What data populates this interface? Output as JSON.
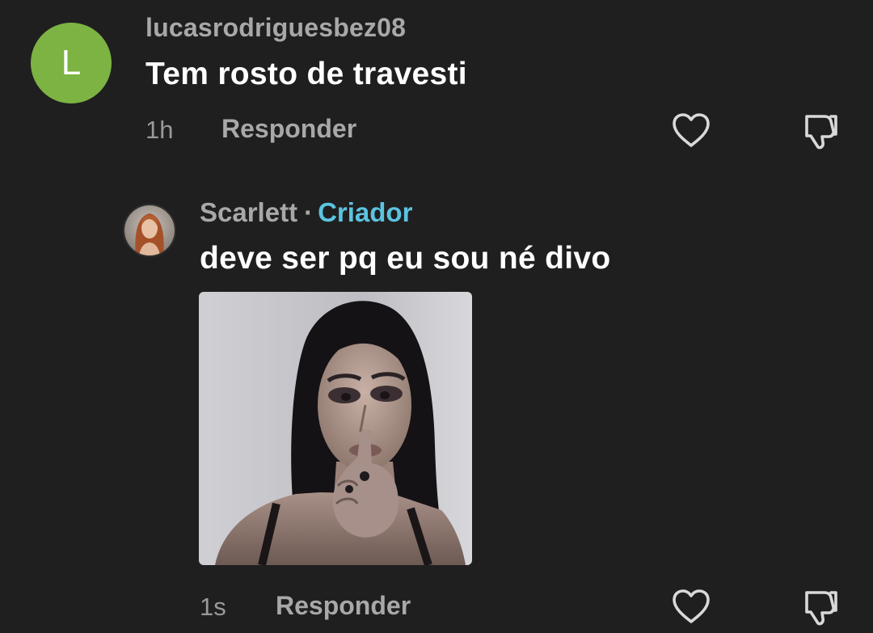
{
  "comments": [
    {
      "avatar_letter": "L",
      "avatar_color": "#7cb342",
      "username": "lucasrodriguesbez08",
      "text": "Tem rosto de travesti",
      "time": "1h",
      "reply_label": "Responder",
      "like_icon": "heart-outline-icon",
      "dislike_icon": "thumbs-down-outline-icon"
    },
    {
      "username": "Scarlett",
      "separator": "·",
      "creator_badge": "Criador",
      "creator_color": "#5cc3e0",
      "text": "deve ser pq eu sou né divo",
      "media": "photo-of-woman-finger-on-lips",
      "time": "1s",
      "reply_label": "Responder",
      "like_icon": "heart-outline-icon",
      "dislike_icon": "thumbs-down-outline-icon"
    }
  ]
}
